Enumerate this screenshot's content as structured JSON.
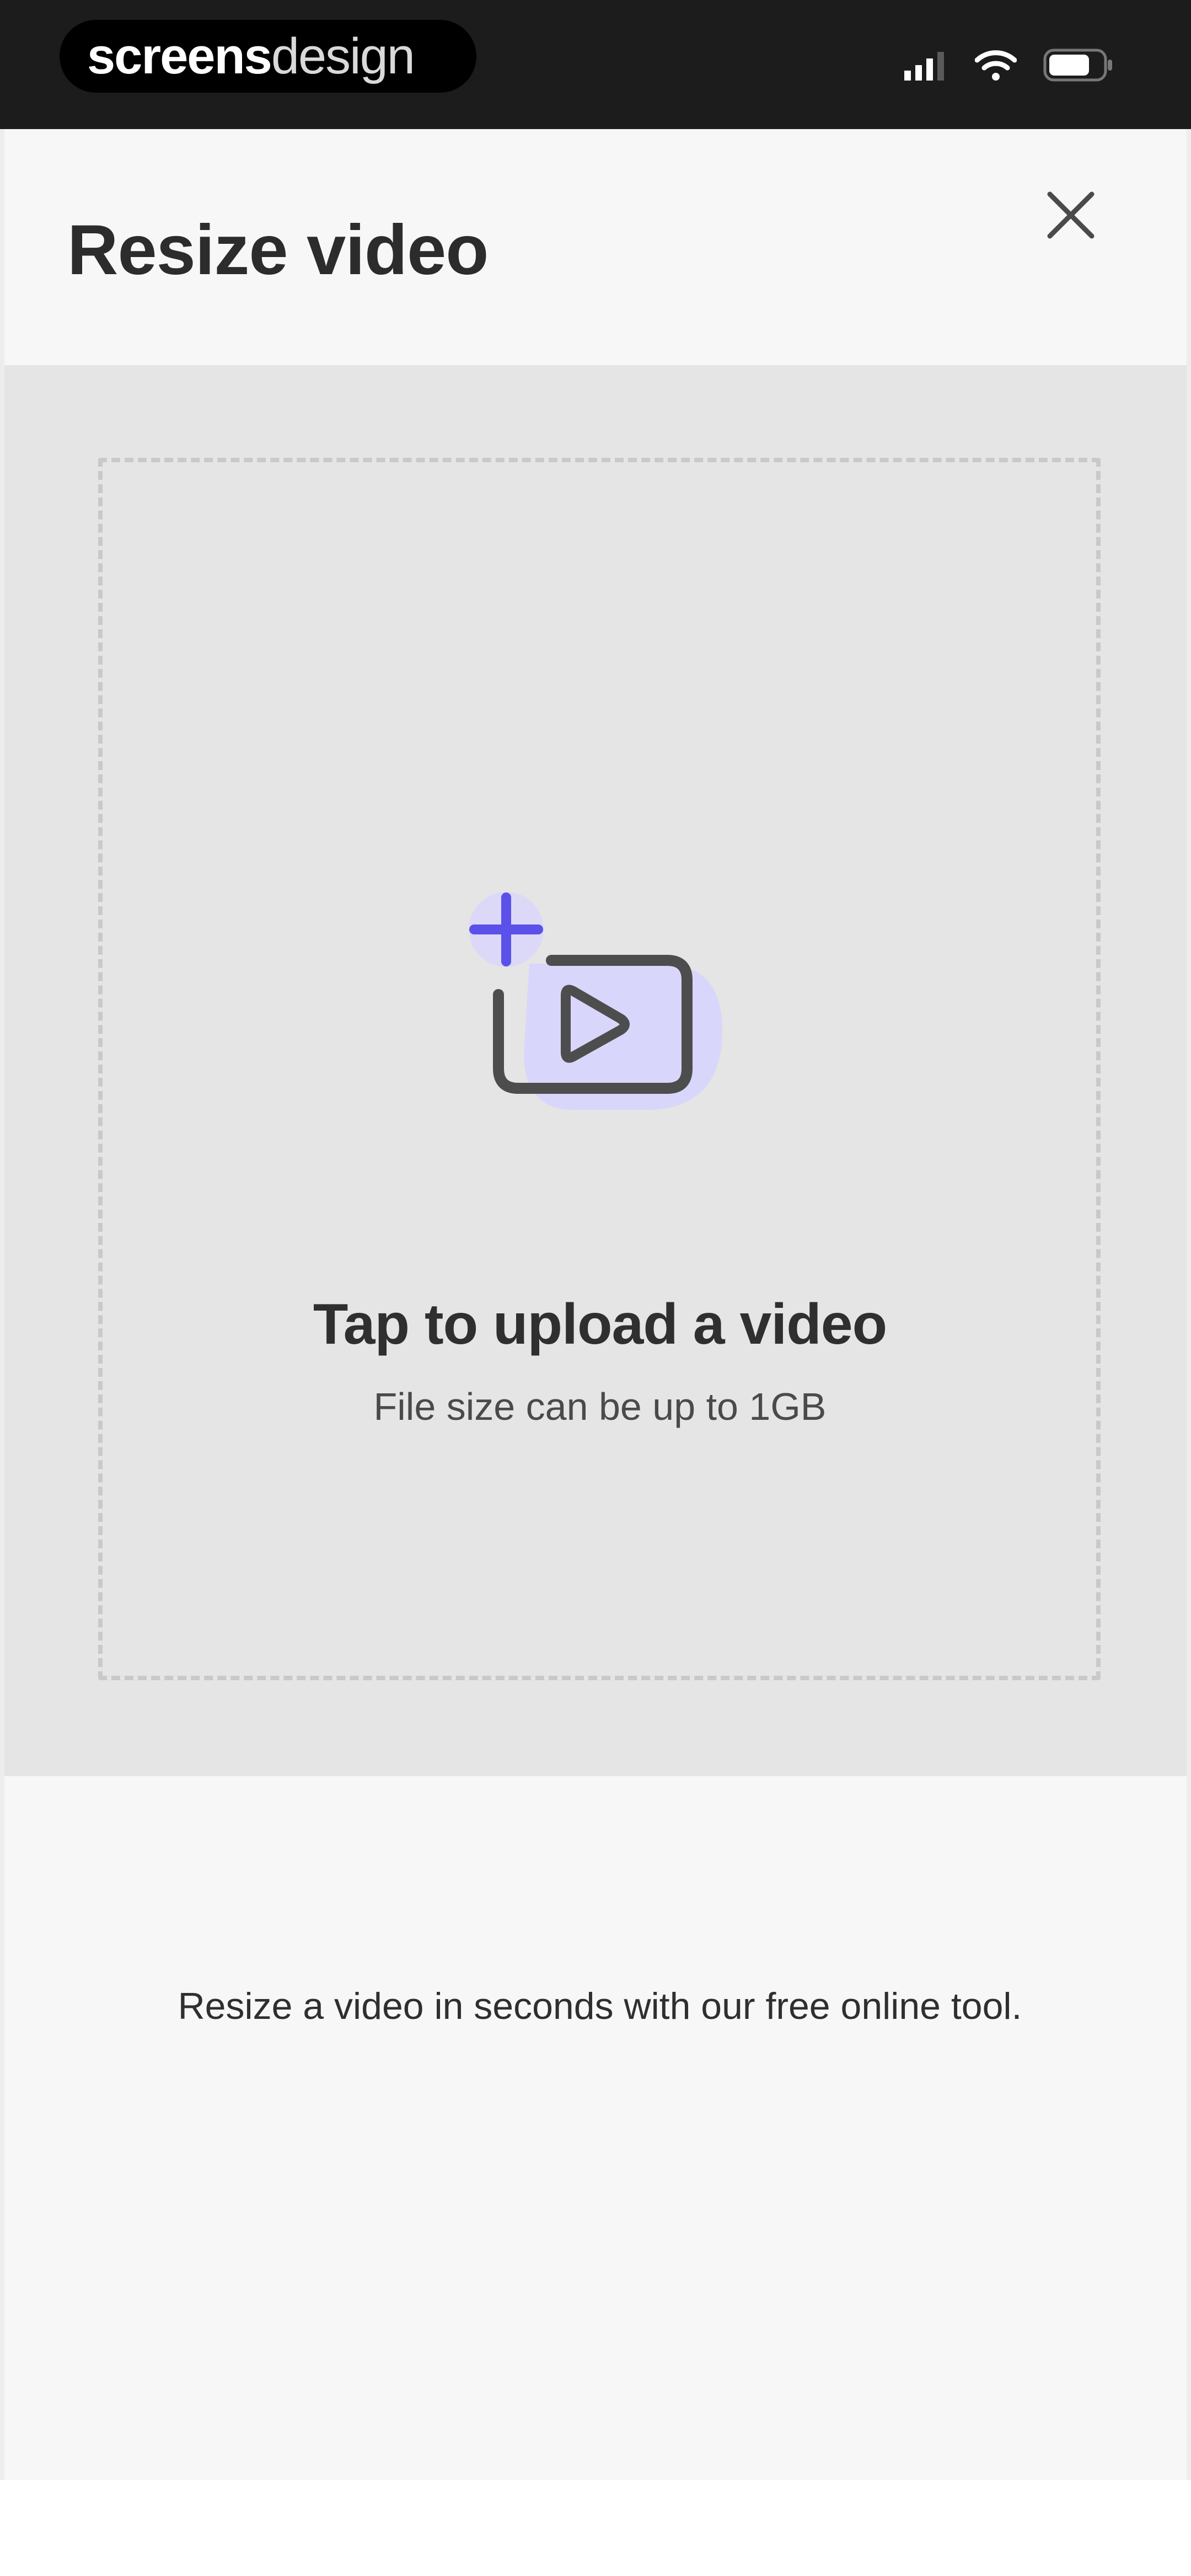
{
  "status_bar": {
    "brand_bold": "screens",
    "brand_light": "design",
    "icons": [
      "signal-icon",
      "wifi-icon",
      "battery-icon"
    ]
  },
  "header": {
    "title": "Resize video",
    "close_icon": "close-icon"
  },
  "upload": {
    "icon": "video-upload-icon",
    "title": "Tap to upload a video",
    "subtitle": "File size can be up to 1GB"
  },
  "description": "Resize a video in seconds with our free online tool.",
  "colors": {
    "accent": "#5b50e8",
    "accent_soft": "#d9d6fb",
    "status_bar_bg": "#1c1c1c",
    "upload_bg": "#e5e5e5",
    "sheet_bg": "#f7f7f7"
  }
}
